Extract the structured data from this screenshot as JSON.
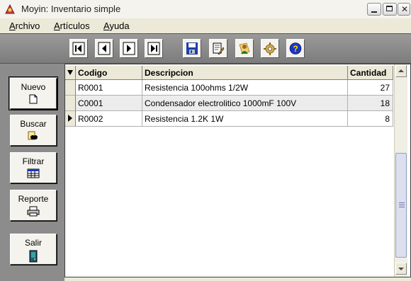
{
  "window": {
    "title": "Moyin: Inventario simple"
  },
  "menu": [
    "Archivo",
    "Artículos",
    "Ayuda"
  ],
  "toolbar": {
    "nav": [
      "first-record-icon",
      "previous-record-icon",
      "next-record-icon",
      "last-record-icon"
    ],
    "actions": [
      "save-disk-icon",
      "document-edit-icon",
      "person-icon",
      "gear-icon",
      "help-icon"
    ]
  },
  "side_buttons": {
    "nuevo": "Nuevo",
    "buscar": "Buscar",
    "filtrar": "Filtrar",
    "reporte": "Reporte",
    "salir": "Salir"
  },
  "grid": {
    "columns": {
      "codigo": "Codigo",
      "descripcion": "Descripcion",
      "cantidad": "Cantidad"
    },
    "rows": [
      {
        "codigo": "R0001",
        "descripcion": "Resistencia 100ohms 1/2W",
        "cantidad": "27"
      },
      {
        "codigo": "C0001",
        "descripcion": "Condensador electrolitico 1000mF 100V",
        "cantidad": "18"
      },
      {
        "codigo": "R0002",
        "descripcion": "Resistencia 1.2K 1W",
        "cantidad": "8"
      }
    ],
    "current_row": 3
  },
  "colors": {
    "toolbar_bg": "#8c8c8c",
    "help_icon": "#1a37c8",
    "save_icon": "#1c3fa8"
  }
}
